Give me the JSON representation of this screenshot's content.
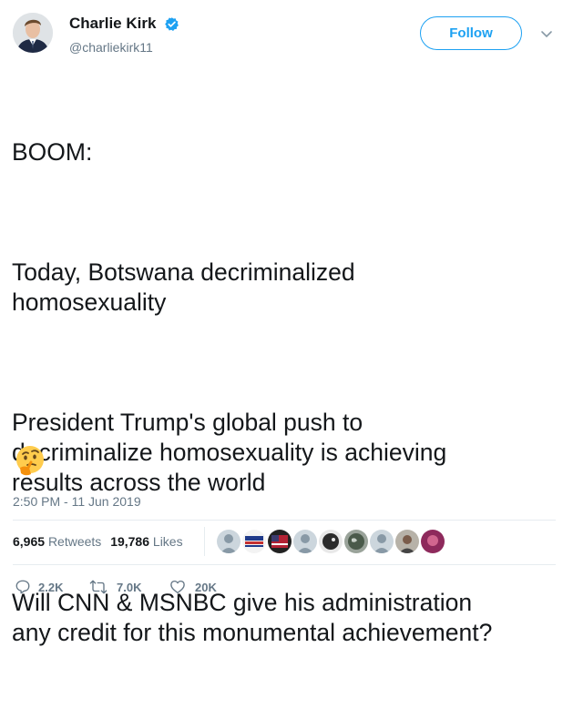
{
  "author": {
    "name": "Charlie Kirk",
    "handle": "@charliekirk11",
    "verified": true,
    "verified_color": "#1da1f2"
  },
  "follow_button": {
    "label": "Follow",
    "color": "#1da1f2"
  },
  "tweet": {
    "paragraphs": [
      "BOOM:",
      "Today, Botswana decriminalized\nhomosexuality",
      "President Trump's global push to\ndecriminalize homosexuality is achieving\nresults across the world",
      "Will CNN & MSNBC give his administration\nany credit for this monumental achievement?"
    ],
    "emoji_icon": "thinking-face-icon",
    "timestamp": "2:50 PM - 11 Jun 2019"
  },
  "stats": {
    "retweets_count": "6,965",
    "retweets_label": "Retweets",
    "likes_count": "19,786",
    "likes_label": "Likes"
  },
  "likers": [
    {
      "icon": "default-avatar-icon",
      "color": "#8899a6"
    },
    {
      "icon": "trump-sign-avatar-icon",
      "color": "#c53030"
    },
    {
      "icon": "flag-avatar-icon",
      "color": "#b22234"
    },
    {
      "icon": "default-avatar-icon",
      "color": "#8899a6"
    },
    {
      "icon": "bird-avatar-icon",
      "color": "#2b2b2b"
    },
    {
      "icon": "earth-avatar-icon",
      "color": "#4a5a4a"
    },
    {
      "icon": "default-avatar-icon",
      "color": "#8899a6"
    },
    {
      "icon": "person-photo-avatar-icon",
      "color": "#7a5c4a"
    },
    {
      "icon": "pink-avatar-icon",
      "color": "#8e2a5c"
    }
  ],
  "actions": {
    "reply_count": "2.2K",
    "retweet_count": "7.0K",
    "like_count": "20K"
  },
  "colors": {
    "text": "#14171a",
    "secondary": "#657786",
    "divider": "#e6ecf0",
    "accent": "#1da1f2"
  }
}
